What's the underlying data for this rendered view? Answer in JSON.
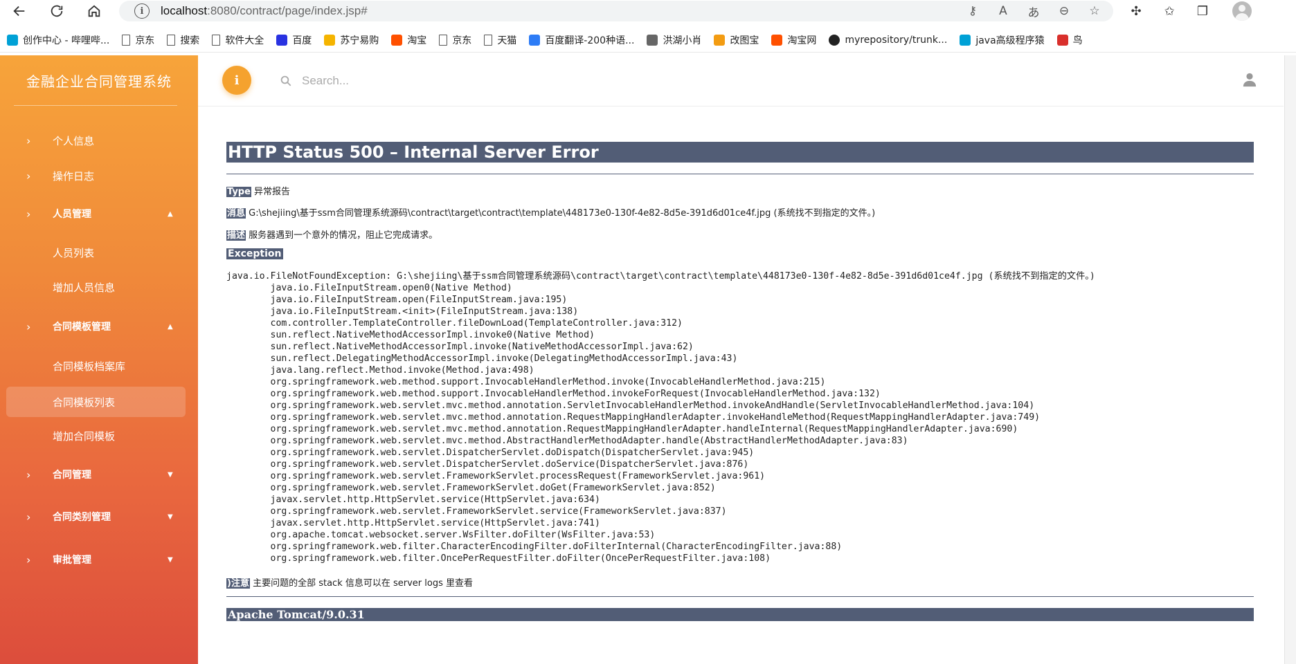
{
  "browser": {
    "url_host": "localhost",
    "url_rest": ":8080/contract/page/index.jsp#",
    "bookmarks": [
      {
        "label": "创作中心 - 哔哩哔...",
        "icon": "bilibili-icon",
        "color": "#00a1d6"
      },
      {
        "label": "京东",
        "icon": "document-icon",
        "color": ""
      },
      {
        "label": "搜索",
        "icon": "document-icon",
        "color": ""
      },
      {
        "label": "软件大全",
        "icon": "document-icon",
        "color": ""
      },
      {
        "label": "百度",
        "icon": "baidu-paw-icon",
        "color": "#2932e1"
      },
      {
        "label": "苏宁易购",
        "icon": "suning-icon",
        "color": "#f5b400"
      },
      {
        "label": "淘宝",
        "icon": "taobao-icon",
        "color": "#ff5000"
      },
      {
        "label": "京东",
        "icon": "document-icon",
        "color": ""
      },
      {
        "label": "天猫",
        "icon": "document-icon",
        "color": ""
      },
      {
        "label": "百度翻译-200种语...",
        "icon": "translate-icon",
        "color": "#2d7cf6"
      },
      {
        "label": "洪湖小肖",
        "icon": "bird-icon",
        "color": "#666666"
      },
      {
        "label": "改图宝",
        "icon": "gaitubao-icon",
        "color": "#f39c12"
      },
      {
        "label": "淘宝网",
        "icon": "taobao-icon",
        "color": "#ff5000"
      },
      {
        "label": "myrepository/trunk...",
        "icon": "github-icon",
        "color": "#222222"
      },
      {
        "label": "java高级程序猿",
        "icon": "bilibili-icon",
        "color": "#00a1d6"
      },
      {
        "label": "鸟",
        "icon": "bird-red-icon",
        "color": "#d9302c"
      }
    ]
  },
  "app": {
    "brand": "金融企业合同管理系统",
    "search_placeholder": "Search...",
    "info_glyph": "i",
    "menu": {
      "personal_info": "个人信息",
      "operation_log": "操作日志",
      "staff_mgmt": "人员管理",
      "staff_list": "人员列表",
      "add_staff": "增加人员信息",
      "template_mgmt": "合同模板管理",
      "template_archive": "合同模板档案库",
      "template_list": "合同模板列表",
      "add_template": "增加合同模板",
      "contract_mgmt": "合同管理",
      "contract_type_mgmt": "合同类别管理",
      "approval_mgmt": "审批管理"
    },
    "accent": "#f5a22e"
  },
  "error": {
    "title": "HTTP Status 500 – Internal Server Error",
    "type_tag": "Type",
    "type_value": " 异常报告",
    "message_tag": "消息",
    "message_value": " G:\\shejiing\\基于ssm合同管理系统源码\\contract\\target\\contract\\template\\448173e0-130f-4e82-8d5e-391d6d01ce4f.jpg (系统找不到指定的文件。)",
    "desc_tag": "描述",
    "desc_value": " 服务器遇到一个意外的情况，阻止它完成请求。",
    "exception_heading": "Exception",
    "stack_trace": "java.io.FileNotFoundException: G:\\shejiing\\基于ssm合同管理系统源码\\contract\\target\\contract\\template\\448173e0-130f-4e82-8d5e-391d6d01ce4f.jpg (系统找不到指定的文件。)\n\tjava.io.FileInputStream.open0(Native Method)\n\tjava.io.FileInputStream.open(FileInputStream.java:195)\n\tjava.io.FileInputStream.<init>(FileInputStream.java:138)\n\tcom.controller.TemplateController.fileDownLoad(TemplateController.java:312)\n\tsun.reflect.NativeMethodAccessorImpl.invoke0(Native Method)\n\tsun.reflect.NativeMethodAccessorImpl.invoke(NativeMethodAccessorImpl.java:62)\n\tsun.reflect.DelegatingMethodAccessorImpl.invoke(DelegatingMethodAccessorImpl.java:43)\n\tjava.lang.reflect.Method.invoke(Method.java:498)\n\torg.springframework.web.method.support.InvocableHandlerMethod.invoke(InvocableHandlerMethod.java:215)\n\torg.springframework.web.method.support.InvocableHandlerMethod.invokeForRequest(InvocableHandlerMethod.java:132)\n\torg.springframework.web.servlet.mvc.method.annotation.ServletInvocableHandlerMethod.invokeAndHandle(ServletInvocableHandlerMethod.java:104)\n\torg.springframework.web.servlet.mvc.method.annotation.RequestMappingHandlerAdapter.invokeHandleMethod(RequestMappingHandlerAdapter.java:749)\n\torg.springframework.web.servlet.mvc.method.annotation.RequestMappingHandlerAdapter.handleInternal(RequestMappingHandlerAdapter.java:690)\n\torg.springframework.web.servlet.mvc.method.AbstractHandlerMethodAdapter.handle(AbstractHandlerMethodAdapter.java:83)\n\torg.springframework.web.servlet.DispatcherServlet.doDispatch(DispatcherServlet.java:945)\n\torg.springframework.web.servlet.DispatcherServlet.doService(DispatcherServlet.java:876)\n\torg.springframework.web.servlet.FrameworkServlet.processRequest(FrameworkServlet.java:961)\n\torg.springframework.web.servlet.FrameworkServlet.doGet(FrameworkServlet.java:852)\n\tjavax.servlet.http.HttpServlet.service(HttpServlet.java:634)\n\torg.springframework.web.servlet.FrameworkServlet.service(FrameworkServlet.java:837)\n\tjavax.servlet.http.HttpServlet.service(HttpServlet.java:741)\n\torg.apache.tomcat.websocket.server.WsFilter.doFilter(WsFilter.java:53)\n\torg.springframework.web.filter.CharacterEncodingFilter.doFilterInternal(CharacterEncodingFilter.java:88)\n\torg.springframework.web.filter.OncePerRequestFilter.doFilter(OncePerRequestFilter.java:108)",
    "note_tag": ")注意",
    "note_value": " 主要问题的全部 stack 信息可以在 server logs 里查看",
    "footer": "Apache Tomcat/9.0.31",
    "tomcat_color": "#525d76"
  }
}
